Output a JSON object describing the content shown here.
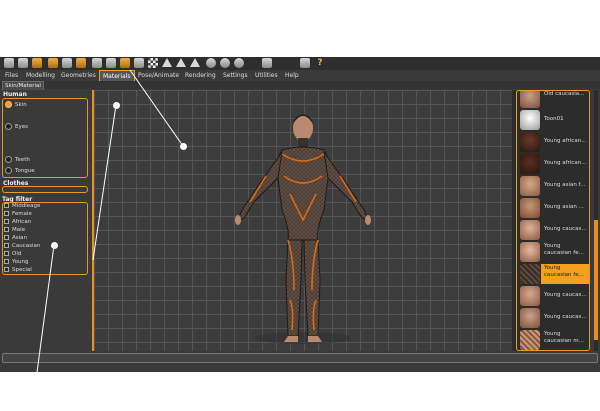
{
  "menu": {
    "tabs": [
      "Files",
      "Modelling",
      "Geometries",
      "Materials",
      "Pose/Animate",
      "Rendering",
      "Settings",
      "Utilities",
      "Help"
    ],
    "active_tab": "Materials"
  },
  "subtab": "Skin/Material",
  "human_panel": {
    "title": "Human",
    "items": [
      "Skin",
      "Eyes",
      "Teeth",
      "Tongue"
    ]
  },
  "clothes_panel": {
    "title": "Clothes"
  },
  "tag_filter": {
    "title": "Tag filter",
    "tags": [
      "Middleage",
      "Female",
      "African",
      "Male",
      "Asian",
      "Caucasian",
      "Old",
      "Young",
      "Special"
    ]
  },
  "materials": [
    "Old caucasia...",
    "Toon01",
    "Young african...",
    "Young african...",
    "Young asian f...",
    "Young asian ...",
    "Young caucas...",
    "Young caucasian fe...",
    "Young caucasian fe...",
    "Young caucas...",
    "Young caucas...",
    "Young caucasian m..."
  ],
  "selected_material_index": 8,
  "colors": {
    "accent": "#f2a01e",
    "panel": "#3a3a3a",
    "viewport": "#3d3d3d"
  },
  "toolbar_icons": [
    "new-icon",
    "save-icon",
    "export-icon",
    "undo-icon",
    "redo-icon",
    "reset-icon",
    "wireframe-icon",
    "pose-icon",
    "smooth-icon",
    "grid-icon",
    "checker-icon",
    "front-view-icon",
    "back-view-icon",
    "left-view-icon",
    "right-view-icon",
    "top-view-icon",
    "bottom-view-icon",
    "reset-camera-icon",
    "screenshot-icon",
    "help-icon"
  ]
}
